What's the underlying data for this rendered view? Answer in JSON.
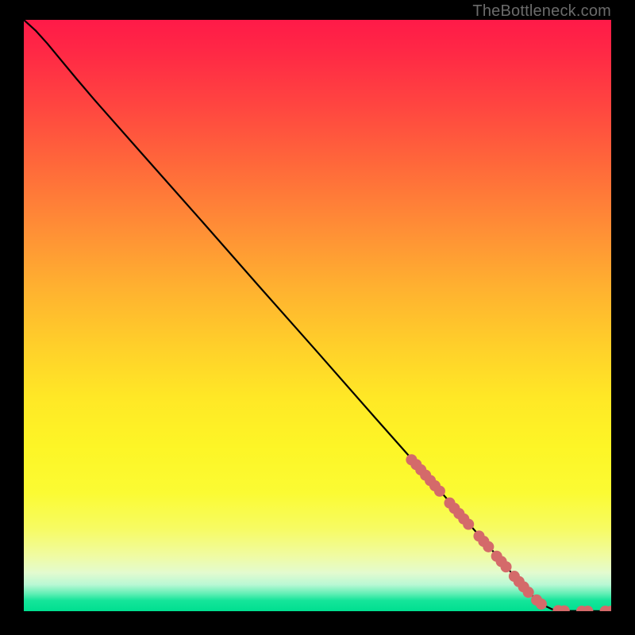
{
  "watermark": "TheBottleneck.com",
  "chart_data": {
    "type": "line",
    "title": "",
    "xlabel": "",
    "ylabel": "",
    "xlim": [
      0,
      100
    ],
    "ylim": [
      0,
      100
    ],
    "grid": false,
    "line": {
      "points": [
        {
          "x": 0,
          "y": 100
        },
        {
          "x": 2,
          "y": 98.2
        },
        {
          "x": 4,
          "y": 96.0
        },
        {
          "x": 6.5,
          "y": 93.0
        },
        {
          "x": 9,
          "y": 90.0
        },
        {
          "x": 12,
          "y": 86.5
        },
        {
          "x": 20,
          "y": 77.5
        },
        {
          "x": 30,
          "y": 66.3
        },
        {
          "x": 40,
          "y": 55.0
        },
        {
          "x": 50,
          "y": 43.8
        },
        {
          "x": 60,
          "y": 32.5
        },
        {
          "x": 70,
          "y": 21.3
        },
        {
          "x": 80,
          "y": 10.0
        },
        {
          "x": 85,
          "y": 4.2
        },
        {
          "x": 87,
          "y": 2.2
        },
        {
          "x": 88.5,
          "y": 1.0
        },
        {
          "x": 90,
          "y": 0.3
        },
        {
          "x": 92,
          "y": 0.05
        },
        {
          "x": 100,
          "y": 0.0
        }
      ]
    },
    "markers": {
      "color": "#d46a6a",
      "radius_pct": 0.95,
      "points": [
        {
          "x": 66.0,
          "y": 25.6
        },
        {
          "x": 66.8,
          "y": 24.8
        },
        {
          "x": 67.6,
          "y": 23.9
        },
        {
          "x": 68.4,
          "y": 23.0
        },
        {
          "x": 69.2,
          "y": 22.1
        },
        {
          "x": 70.0,
          "y": 21.2
        },
        {
          "x": 70.8,
          "y": 20.3
        },
        {
          "x": 72.5,
          "y": 18.3
        },
        {
          "x": 73.3,
          "y": 17.4
        },
        {
          "x": 74.1,
          "y": 16.5
        },
        {
          "x": 74.9,
          "y": 15.6
        },
        {
          "x": 75.7,
          "y": 14.7
        },
        {
          "x": 77.5,
          "y": 12.7
        },
        {
          "x": 78.3,
          "y": 11.8
        },
        {
          "x": 79.1,
          "y": 10.9
        },
        {
          "x": 80.5,
          "y": 9.3
        },
        {
          "x": 81.3,
          "y": 8.4
        },
        {
          "x": 82.1,
          "y": 7.5
        },
        {
          "x": 83.5,
          "y": 5.9
        },
        {
          "x": 84.3,
          "y": 5.0
        },
        {
          "x": 85.1,
          "y": 4.1
        },
        {
          "x": 85.9,
          "y": 3.2
        },
        {
          "x": 87.3,
          "y": 1.9
        },
        {
          "x": 88.1,
          "y": 1.2
        },
        {
          "x": 91.0,
          "y": 0.1
        },
        {
          "x": 92.0,
          "y": 0.05
        },
        {
          "x": 95.0,
          "y": 0.0
        },
        {
          "x": 96.0,
          "y": 0.0
        },
        {
          "x": 99.0,
          "y": 0.0
        },
        {
          "x": 100.0,
          "y": 0.0
        }
      ]
    }
  }
}
